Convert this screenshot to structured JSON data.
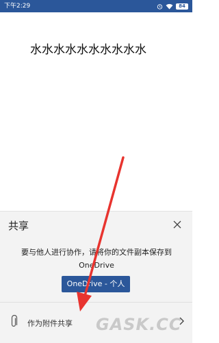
{
  "status_bar": {
    "time": "下午2:29",
    "alarm_icon": "alarm-icon",
    "wifi_icon": "wifi-icon",
    "battery": "84",
    "bg_color": "#2b579a"
  },
  "document": {
    "text": "水水水水水水水水水水"
  },
  "share_sheet": {
    "title": "共享",
    "close_icon": "close-icon",
    "description": "要与他人进行协作，请将你的文件副本保存到 OneDrive",
    "onedrive_button": "OneDrive - 个人",
    "attachment_label": "作为附件共享",
    "attachment_icon": "paperclip-icon",
    "chevron_icon": "chevron-right-icon",
    "accent_color": "#2b579a"
  },
  "watermark": {
    "text": "GASK.CC"
  },
  "annotation": {
    "arrow_color": "#e8342f"
  }
}
